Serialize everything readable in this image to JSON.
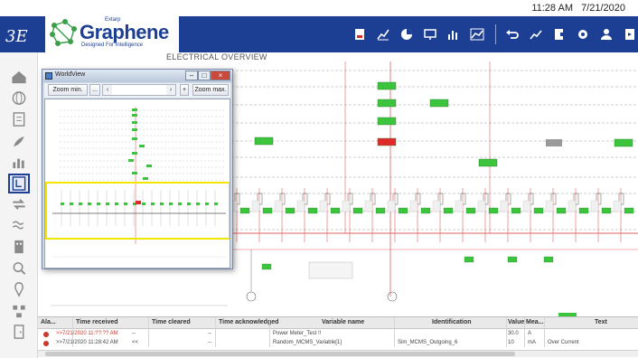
{
  "topbar": {
    "time": "11:28 AM",
    "date": "7/21/2020"
  },
  "brand": {
    "mark": "3E",
    "name": "Graphene",
    "superscript": "Extarp",
    "tagline": "Designed For Intelligence"
  },
  "colors": {
    "header": "#1c3f94",
    "device_green": "#3cc43c",
    "alarm_red": "#e02a2a",
    "bus_red": "#e06060",
    "window_highlight": "#f2e600"
  },
  "toolbar_icons": [
    "report-icon",
    "line-chart-icon",
    "pie-chart-icon",
    "monitor-icon",
    "bar-chart-icon",
    "trend-icon",
    "undo-icon",
    "area-chart-icon",
    "export-icon",
    "settings-icon",
    "user-icon",
    "logout-icon",
    "info-icon"
  ],
  "sidebar_icons": [
    "home-icon",
    "globe-icon",
    "list-icon",
    "plant-icon",
    "bar-icon",
    "electrical-icon",
    "transfer-icon",
    "hvac-icon",
    "building-icon",
    "search-icon",
    "location-icon",
    "network-icon",
    "door-icon"
  ],
  "page": {
    "title": "ELECTRICAL OVERVIEW"
  },
  "worldview": {
    "title": "WorldView",
    "zoom_min": "Zoom min.",
    "zoom_max": "Zoom max.",
    "dots": "...",
    "plus": "+"
  },
  "alarms": {
    "headers": [
      "Ala...",
      "Time received",
      "Time cleared",
      "Time acknowledged",
      "Variable name",
      "Identification",
      "Value",
      "Mea...",
      "Text"
    ],
    "rows": [
      {
        "received": ">>7/21/2020 11:??:?? AM",
        "cleared": "--",
        "acknowledged": "--",
        "variable": "Power Meter_Test !!",
        "identification": "",
        "value": "30.0",
        "measure": "A",
        "text": ""
      },
      {
        "received": ">>7/21/2020 11:28:42 AM",
        "cleared": "<<",
        "acknowledged": "--",
        "variable": "Random_MCMS_Variable[1]",
        "identification": "Sim_MCMS_Outgoing_6",
        "value": "10",
        "measure": "mA",
        "text": "Over Current"
      }
    ]
  }
}
